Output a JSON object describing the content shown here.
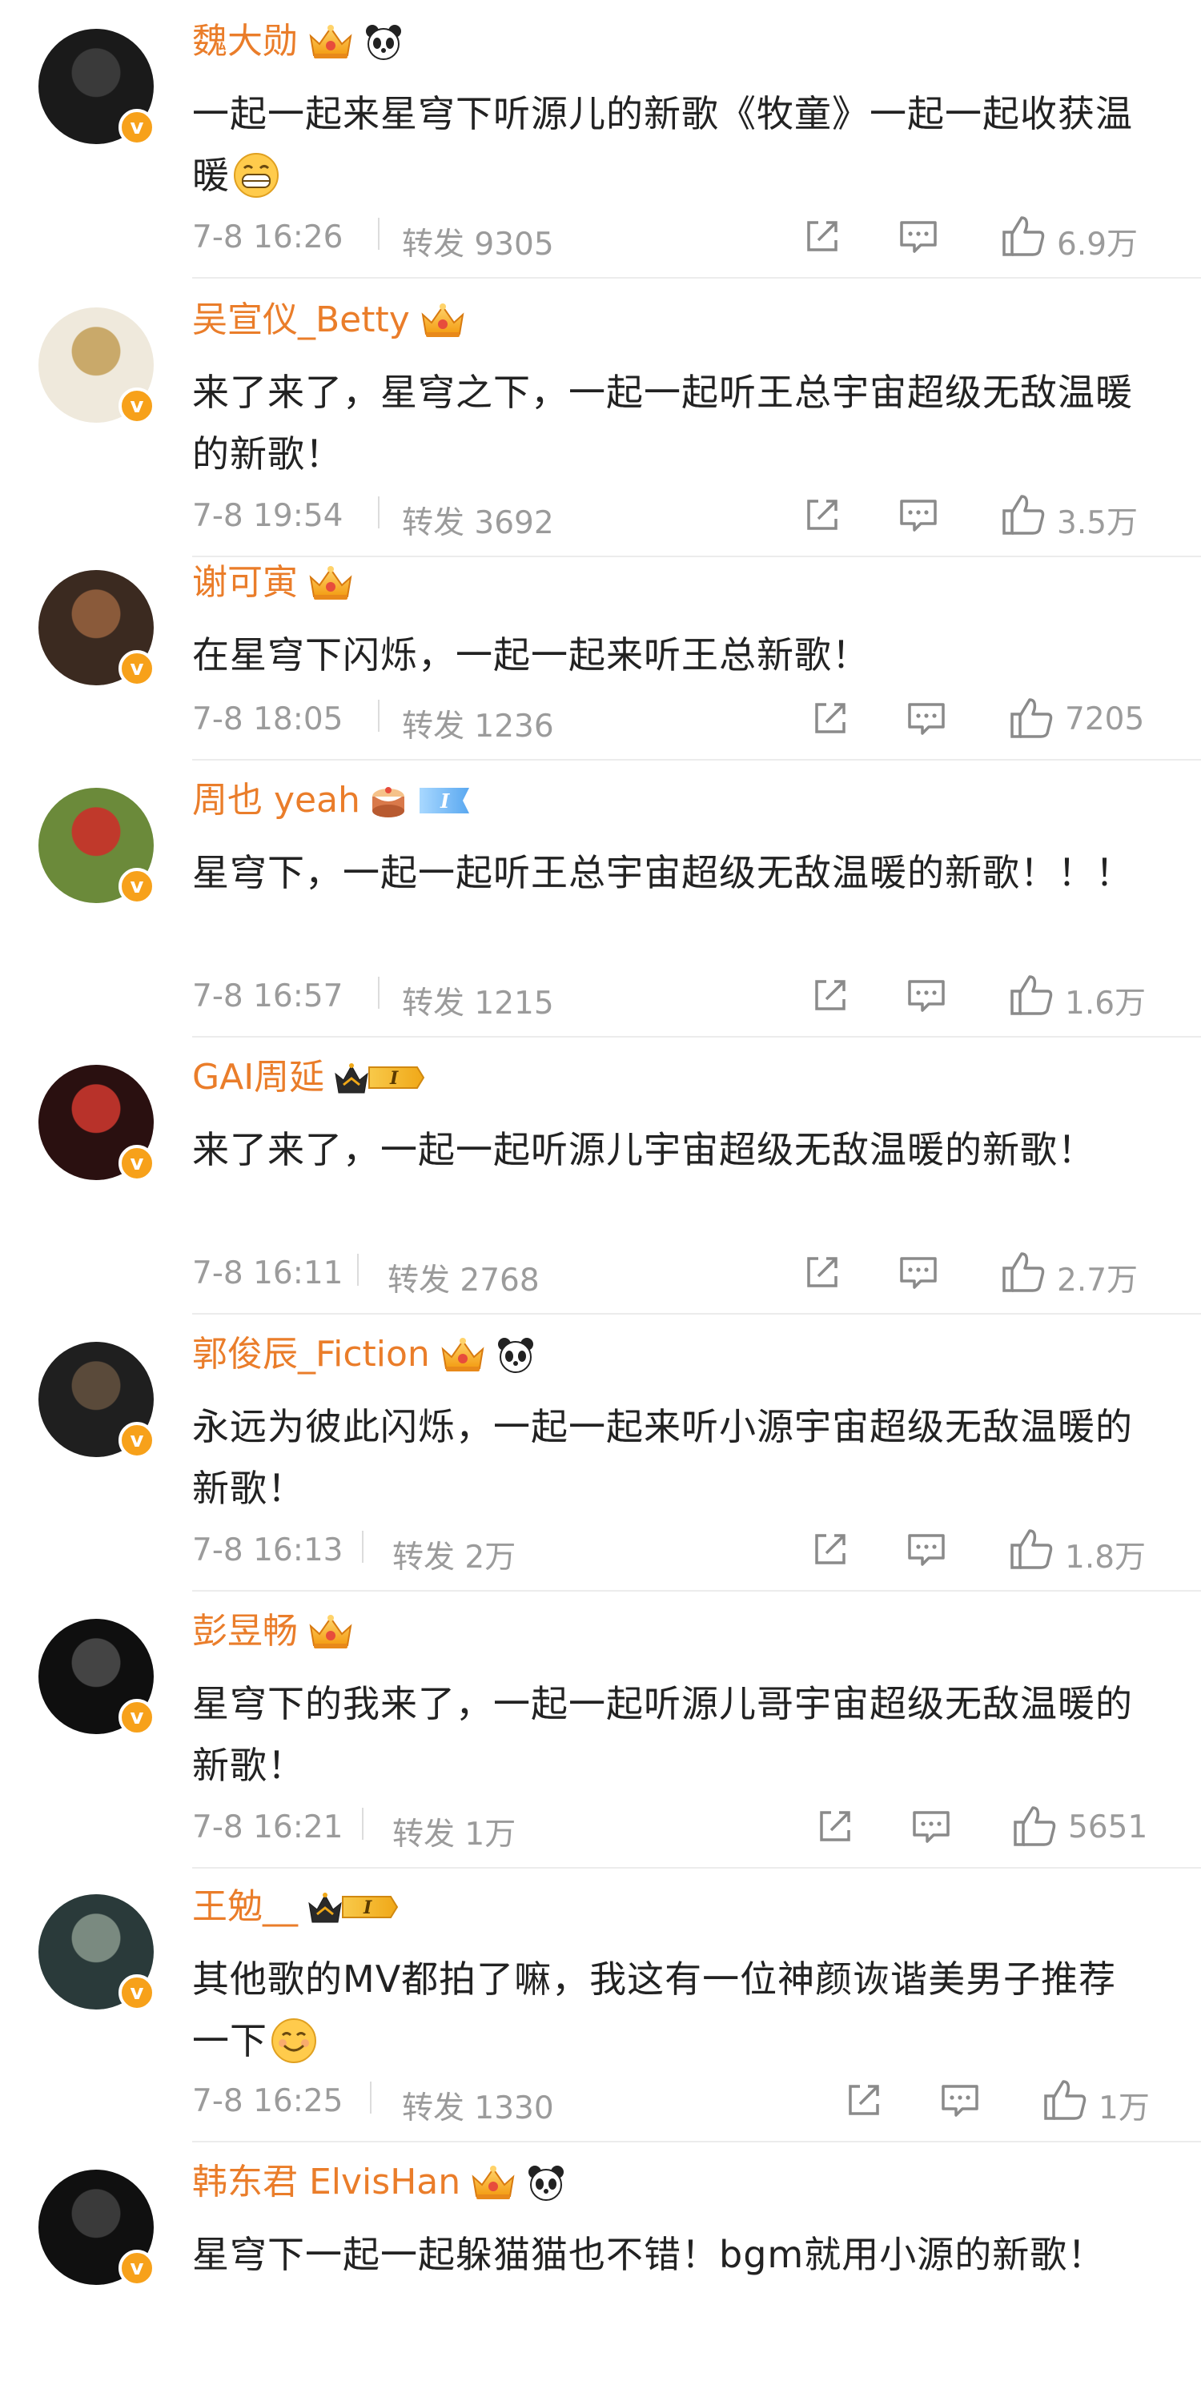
{
  "colors": {
    "username": "#ea7d2a",
    "text": "#222222",
    "meta": "#9b9b9b",
    "verified": "#f7a11a"
  },
  "labels": {
    "repost": "转发"
  },
  "comments": [
    {
      "username": "魏大勋",
      "badges": [
        "crown-icon",
        "panda-icon"
      ],
      "text": "一起一起来星穹下听源儿的新歌《牧童》一起一起收获温暖",
      "emoji": "grin-emoji-icon",
      "time": "7-8 16:26",
      "reposts": "9305",
      "likes": "6.9万"
    },
    {
      "username": "吴宣仪_Betty",
      "badges": [
        "crown-icon"
      ],
      "text": "来了来了，星穹之下，一起一起听王总宇宙超级无敌温暖的新歌！",
      "time": "7-8 19:54",
      "reposts": "3692",
      "likes": "3.5万"
    },
    {
      "username": "谢可寅",
      "badges": [
        "crown-icon"
      ],
      "text": "在星穹下闪烁，一起一起来听王总新歌！",
      "time": "7-8 18:05",
      "reposts": "1236",
      "likes": "7205"
    },
    {
      "username": "周也 yeah",
      "badges": [
        "cake-icon",
        "vip-level-icon"
      ],
      "text": "星穹下，一起一起听王总宇宙超级无敌温暖的新歌！！！",
      "time": "7-8 16:57",
      "reposts": "1215",
      "likes": "1.6万"
    },
    {
      "username": "GAI周延",
      "badges": [
        "crown-vip-level-icon"
      ],
      "text": "来了来了，一起一起听源儿宇宙超级无敌温暖的新歌！",
      "time": "7-8 16:11",
      "reposts": "2768",
      "likes": "2.7万"
    },
    {
      "username": "郭俊辰_Fiction",
      "badges": [
        "crown-icon",
        "panda-icon"
      ],
      "text": "永远为彼此闪烁，一起一起来听小源宇宙超级无敌温暖的新歌！",
      "time": "7-8 16:13",
      "reposts": "2万",
      "likes": "1.8万"
    },
    {
      "username": "彭昱畅",
      "badges": [
        "crown-icon"
      ],
      "text": "星穹下的我来了，一起一起听源儿哥宇宙超级无敌温暖的新歌！",
      "time": "7-8 16:21",
      "reposts": "1万",
      "likes": "5651"
    },
    {
      "username": "王勉__",
      "badges": [
        "crown-vip-level-icon"
      ],
      "text": "其他歌的MV都拍了嘛，我这有一位神颜诙谐美男子推荐一下",
      "emoji": "smile-emoji-icon",
      "time": "7-8 16:25",
      "reposts": "1330",
      "likes": "1万"
    },
    {
      "username": "韩东君 ElvisHan",
      "badges": [
        "crown-icon",
        "panda-icon"
      ],
      "text": "星穹下一起一起躲猫猫也不错！bgm就用小源的新歌！"
    }
  ]
}
